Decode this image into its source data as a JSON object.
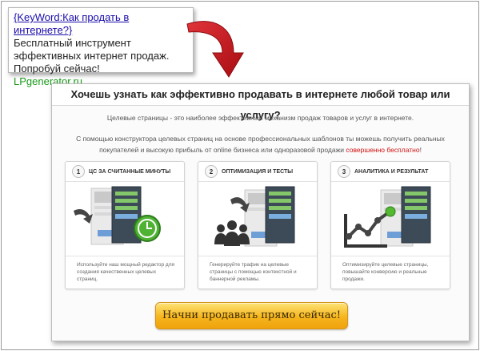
{
  "ad": {
    "title": "{KeyWord:Как продать в интернете?}",
    "body": "Бесплатный инструмент эффективных интернет продаж. Попробуй сейчас!",
    "url": "LPgenerator.ru"
  },
  "landing": {
    "headline": "Хочешь узнать как эффективно продавать в интернете любой товар или услугу?",
    "intro": "Целевые страницы - это наиболее эффективный механизм продаж товаров и услуг в интернете.",
    "paragraph": "С помощью конструктора целевых страниц на основе профессиональных шаблонов ты можешь получить реальных покупателей и высокую прибыль от online бизнеса или одноразовой продажи",
    "paragraph_highlight": "совершенно бесплатно",
    "paragraph_end": "!",
    "cards": [
      {
        "number": "1",
        "title": "ЦС ЗА СЧИТАННЫЕ МИНУТЫ",
        "text": "Используйте наш мощный редактор для создания качественных целевых страниц."
      },
      {
        "number": "2",
        "title": "ОПТИМИЗАЦИЯ И ТЕСТЫ",
        "text": "Генерируйте трафик на целевые страницы с помощью контекстной и баннерной рекламы."
      },
      {
        "number": "3",
        "title": "АНАЛИТИКА И РЕЗУЛЬТАТ",
        "text": "Оптимизируйте целевые страницы, повышайте конверсию и реальные продажи."
      }
    ],
    "cta": "Начни продавать прямо сейчас!"
  },
  "colors": {
    "ad_link": "#1a0dab",
    "ad_url": "#1b9a1b",
    "arrow": "#c8151b",
    "highlight": "#d01010",
    "cta": "#f6b51d"
  },
  "icons": [
    "curved-arrow-icon",
    "clock-icon",
    "people-icon",
    "growth-chart-icon"
  ]
}
